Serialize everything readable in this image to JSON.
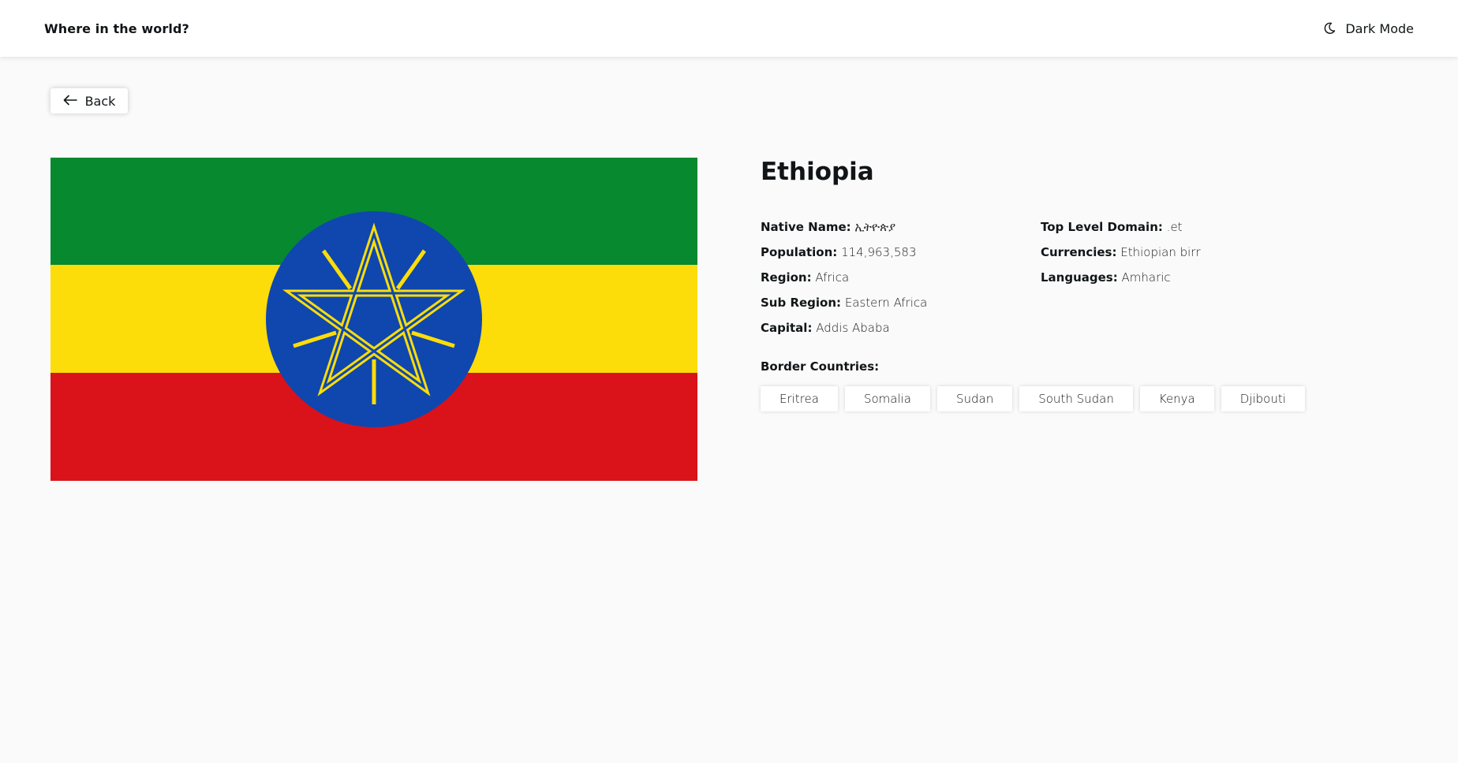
{
  "header": {
    "title": "Where in the world?",
    "theme_toggle_label": "Dark Mode",
    "theme_icon": "moon-icon"
  },
  "back_button": {
    "label": "Back",
    "icon": "arrow-left-icon"
  },
  "country": {
    "name": "Ethiopia",
    "flag": {
      "description_icon": "flag-ethiopia",
      "colors": {
        "green": "#078930",
        "yellow": "#FCDD09",
        "red": "#DA121A",
        "blue": "#0F47AF",
        "star": "#FCDD09"
      }
    },
    "info_left": [
      {
        "label": "Native Name:",
        "value": "ኢትዮጵያ"
      },
      {
        "label": "Population:",
        "value": "114,963,583"
      },
      {
        "label": "Region:",
        "value": "Africa"
      },
      {
        "label": "Sub Region:",
        "value": "Eastern Africa"
      },
      {
        "label": "Capital:",
        "value": "Addis Ababa"
      }
    ],
    "info_right": [
      {
        "label": "Top Level Domain:",
        "value": ".et"
      },
      {
        "label": "Currencies:",
        "value": "Ethiopian birr"
      },
      {
        "label": "Languages:",
        "value": "Amharic"
      }
    ],
    "border_label": "Border Countries:",
    "borders": [
      "Eritrea",
      "Somalia",
      "Sudan",
      "South Sudan",
      "Kenya",
      "Djibouti"
    ]
  }
}
